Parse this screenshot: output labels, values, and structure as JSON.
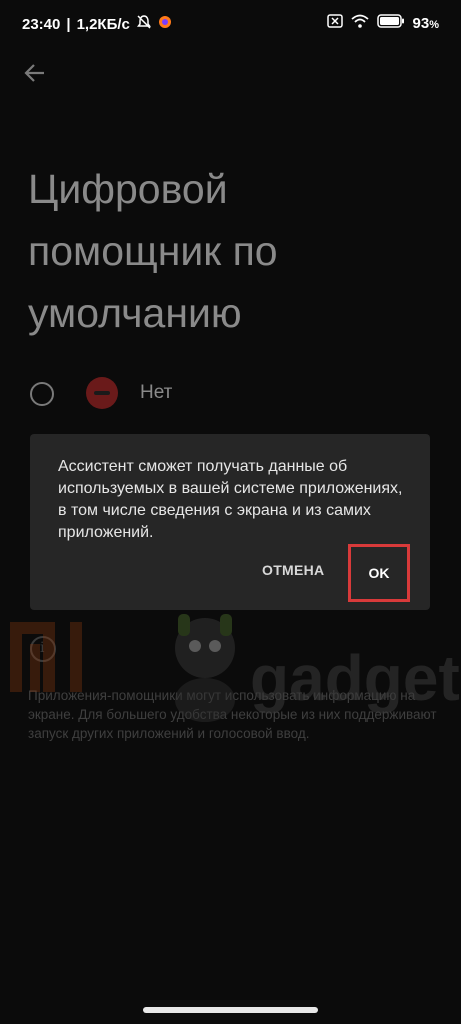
{
  "status_bar": {
    "time": "23:40",
    "separator": "|",
    "net_speed": "1,2КБ/с",
    "battery_pct": "93",
    "battery_suffix": "%",
    "icons": [
      "mute-icon",
      "app-notification-icon",
      "sim-off-icon",
      "wifi-icon",
      "battery-icon"
    ]
  },
  "page": {
    "title": "Цифровой помощник по умолчанию",
    "option_none_label": "Нет"
  },
  "dialog": {
    "message": "Ассистент сможет получать данные об используемых в вашей системе приложениях, в том числе сведения с экрана и из самих приложений.",
    "cancel_label": "ОТМЕНА",
    "ok_label": "OK",
    "highlight_color": "#d83a3a"
  },
  "footer": {
    "text": "Приложения-помощники могут использовать информацию на экране. Для большего удобства некоторые из них поддерживают запуск других приложений и голосовой ввод."
  },
  "watermark": {
    "text": "gadget"
  }
}
